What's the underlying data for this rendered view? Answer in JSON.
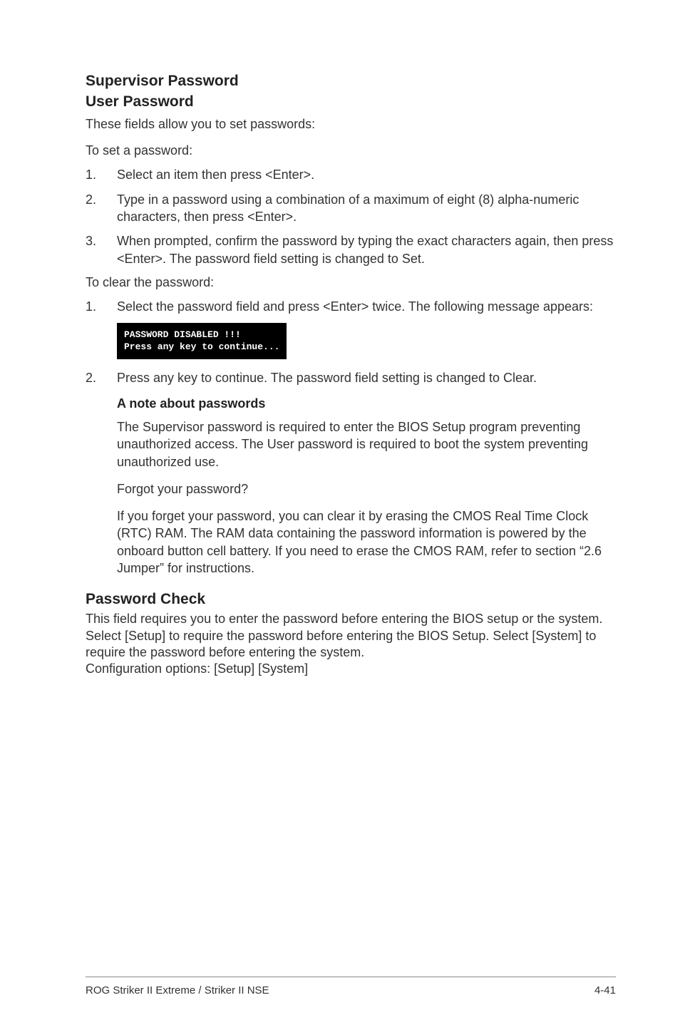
{
  "headings": {
    "supervisor": "Supervisor Password",
    "user": "User Password",
    "note": "A note about passwords",
    "check": "Password Check"
  },
  "intro": {
    "these_fields": "These fields allow you to set passwords:",
    "to_set": "To set a password:"
  },
  "set_list": [
    {
      "n": "1.",
      "t": "Select an item then press <Enter>."
    },
    {
      "n": "2.",
      "t": "Type in a password using a combination of a maximum of eight (8) alpha-numeric characters, then press <Enter>."
    },
    {
      "n": "3.",
      "t": "When prompted, confirm the password by typing the exact characters again, then press <Enter>. The password field setting is changed to Set."
    }
  ],
  "to_clear": "To clear the password:",
  "clear_list1": [
    {
      "n": "1.",
      "t": "Select the password field and press <Enter> twice. The following message appears:"
    }
  ],
  "code": "PASSWORD DISABLED !!!\nPress any key to continue...",
  "clear_list2": [
    {
      "n": "2.",
      "t": "Press any key to continue. The password field setting is changed to Clear."
    }
  ],
  "note_p1": "The Supervisor password is required to enter the BIOS Setup program preventing unauthorized access. The User password is required to boot the system preventing unauthorized use.",
  "note_p2": "Forgot your password?",
  "note_p3": "If you forget your password, you can clear it by erasing the CMOS Real Time Clock (RTC) RAM. The RAM data containing the password information is powered by the onboard button cell battery. If you need to erase the CMOS RAM, refer to section “2.6 Jumper” for instructions.",
  "check_body": "This field requires you to enter the password before entering the BIOS setup or the system. Select [Setup] to require the password before entering the BIOS Setup. Select [System] to require the password before entering the system.\nConfiguration options: [Setup] [System]",
  "footer": {
    "left": "ROG Striker II Extreme / Striker II NSE",
    "right": "4-41"
  }
}
